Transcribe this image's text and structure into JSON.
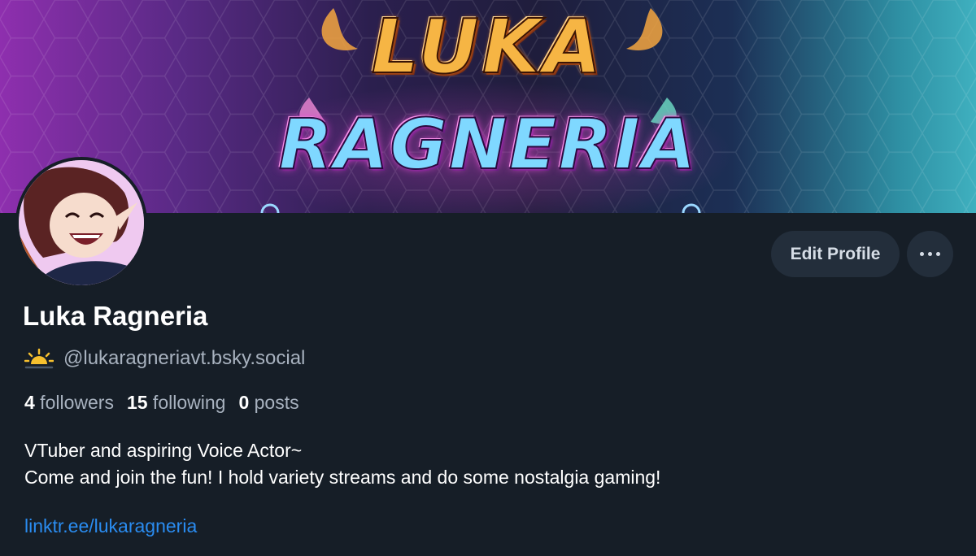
{
  "banner": {
    "logo_line1": "LUKA",
    "logo_line2": "RAGNERIA",
    "colors": {
      "left": "#8e2fae",
      "right": "#3fb0bf",
      "logo_gold": "#f6b544",
      "logo_cyan": "#7fd8ff"
    }
  },
  "profile": {
    "display_name": "Luka Ragneria",
    "handle": "@lukaragneriavt.bsky.social",
    "handle_icon": "sunrise-emoji-icon",
    "stats": {
      "followers_count": "4",
      "followers_label": " followers",
      "following_count": "15",
      "following_label": " following",
      "posts_count": "0",
      "posts_label": " posts"
    },
    "bio_line1": "VTuber and aspiring Voice Actor~",
    "bio_line2": "Come and join the fun! I hold variety streams and do some nostalgia gaming!",
    "link": "linktr.ee/lukaragneria"
  },
  "actions": {
    "edit_profile_label": "Edit Profile",
    "more_icon": "ellipsis-icon"
  },
  "theme": {
    "background": "#161e27",
    "button_bg": "#232e3b",
    "text_primary": "#ffffff",
    "text_secondary": "#a8b2bf",
    "link": "#2a8cf0"
  }
}
